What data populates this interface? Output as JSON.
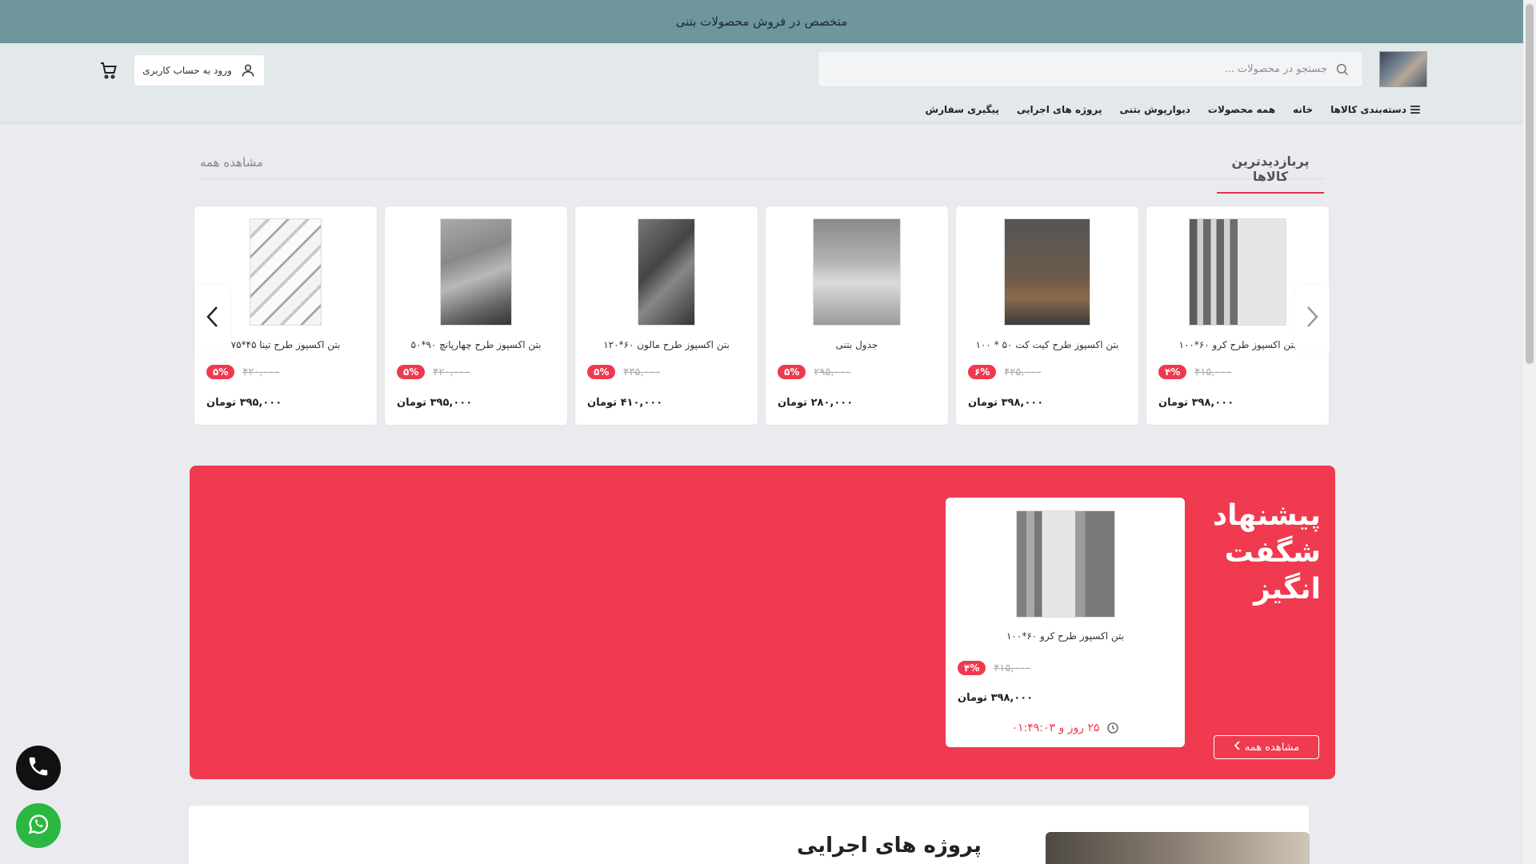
{
  "topbar": {
    "text": "متخصص در فروش محصولات بتنی"
  },
  "header": {
    "search_placeholder": "جستجو در محصولات ...",
    "login_label": "ورود به حساب کاربری"
  },
  "nav": {
    "items": [
      {
        "label": "دسته‌بندی کالاها"
      },
      {
        "label": "خانه"
      },
      {
        "label": "همه محصولات"
      },
      {
        "label": "دیوارپوش بتنی"
      },
      {
        "label": "پروژه های اجرایی"
      },
      {
        "label": "پیگیری سفارش"
      }
    ]
  },
  "most_viewed": {
    "title": "پربازدیدترین کالاها",
    "view_all": "مشاهده همه",
    "products": [
      {
        "title": "بتن اکسپوز طرح کرو ۶۰*۱۰۰",
        "discount": "۴%",
        "old_price": "۴۱۵,۰۰۰",
        "price": "۳۹۸,۰۰۰ تومان"
      },
      {
        "title": "بتن اکسپوز طرح کیت کت ۵۰ * ۱۰۰",
        "discount": "۶%",
        "old_price": "۴۲۵,۰۰۰",
        "price": "۳۹۸,۰۰۰ تومان"
      },
      {
        "title": "جدول بتنی",
        "discount": "۵%",
        "old_price": "۲۹۵,۰۰۰",
        "price": "۲۸۰,۰۰۰ تومان"
      },
      {
        "title": "بتن اکسپوز طرح مالون ۶۰*۱۲۰",
        "discount": "۵%",
        "old_price": "۴۳۵,۰۰۰",
        "price": "۴۱۰,۰۰۰ تومان"
      },
      {
        "title": "بتن اکسپوز طرح چهارپانچ ۹۰*۵۰",
        "discount": "۵%",
        "old_price": "۴۲۰,۰۰۰",
        "price": "۳۹۵,۰۰۰ تومان"
      },
      {
        "title": "بتن اکسپوز طرح تینا ۴۵*۷۵",
        "discount": "۵%",
        "old_price": "۴۲۰,۰۰۰",
        "price": "۳۹۵,۰۰۰ تومان"
      }
    ]
  },
  "amazing": {
    "title_line1": "پیشنهاد",
    "title_line2": "شگفت",
    "title_line3": "انگیز",
    "view_all": "مشاهده همه",
    "product": {
      "title": "بتن اکسپوز طرح کرو ۶۰*۱۰۰",
      "discount": "۴%",
      "old_price": "۴۱۵,۰۰۰",
      "price": "۳۹۸,۰۰۰ تومان",
      "timer": "۲۵ روز و ۰۱:۴۹:۰۳"
    }
  },
  "projects": {
    "title": "پروژه های اجرایی"
  },
  "colors": {
    "accent": "#ef3a4f",
    "topbar": "#6e969c"
  }
}
